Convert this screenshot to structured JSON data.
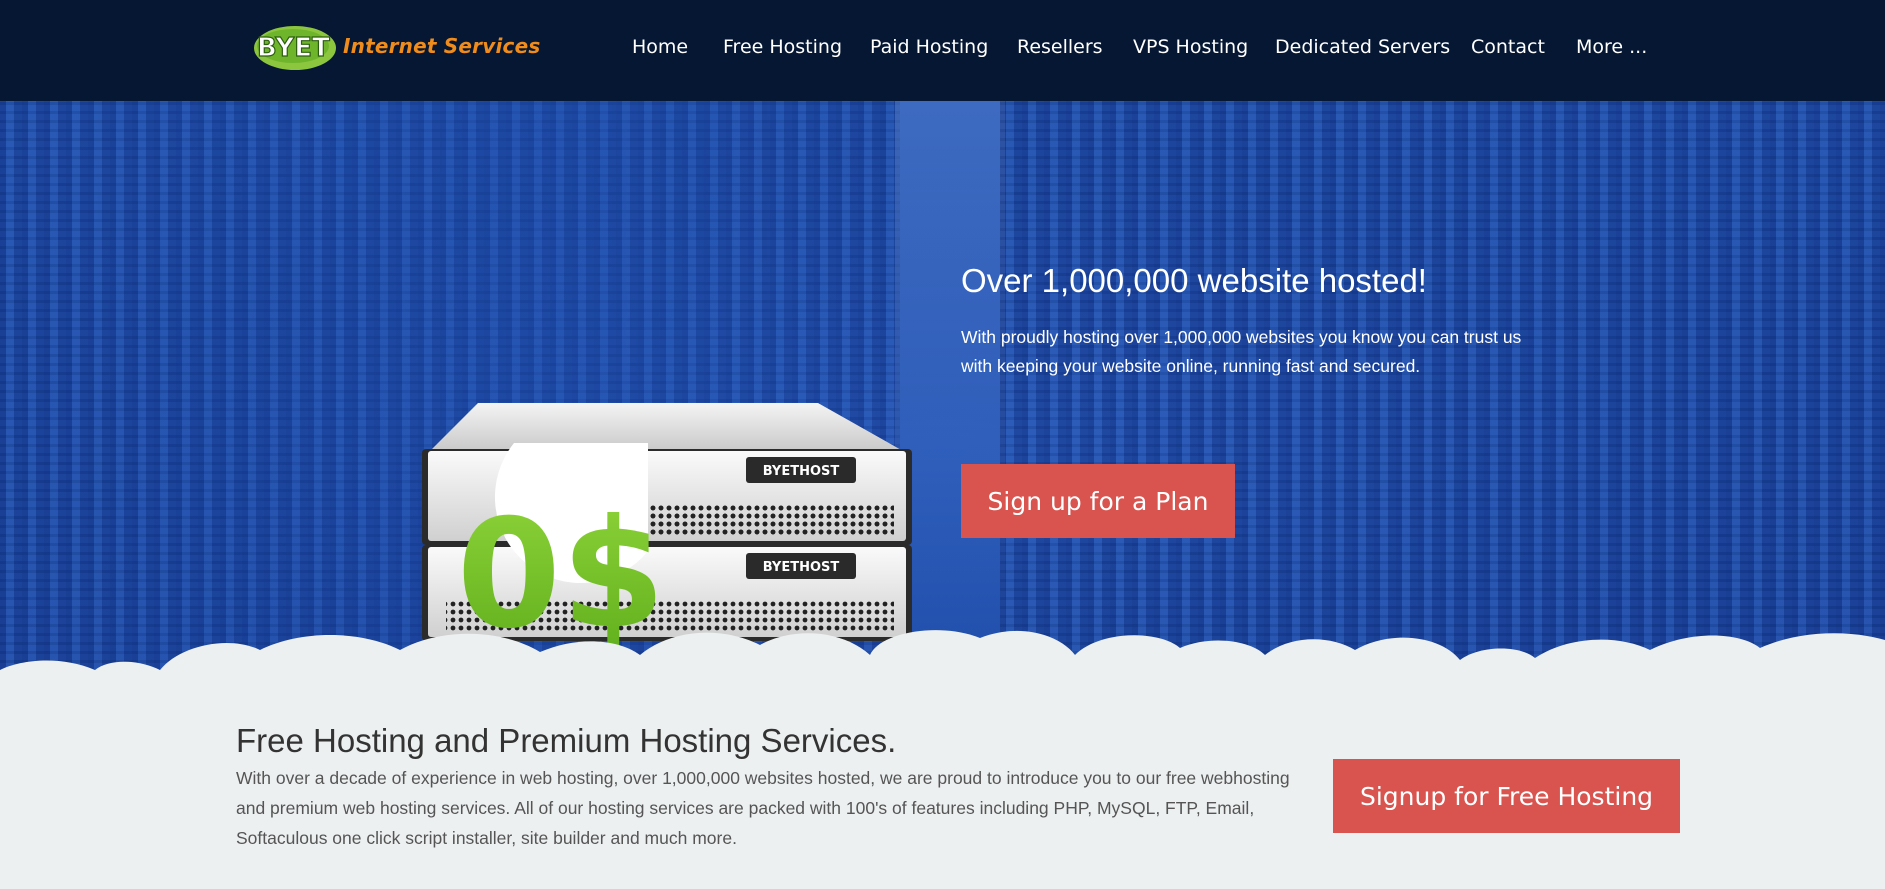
{
  "header": {
    "logo_text": "Internet Services",
    "logo_mark": "BYET",
    "nav": [
      {
        "label": "Home"
      },
      {
        "label": "Free Hosting"
      },
      {
        "label": "Paid Hosting"
      },
      {
        "label": "Resellers"
      },
      {
        "label": "VPS Hosting"
      },
      {
        "label": "Dedicated Servers"
      },
      {
        "label": "Contact"
      },
      {
        "label": "More ..."
      }
    ]
  },
  "hero": {
    "title": "Over 1,000,000 website hosted!",
    "text": "With proudly hosting over 1,000,000 websites you know you can trust us with keeping your website online, running fast and secured.",
    "cta_label": "Sign up for a Plan",
    "server_badge": "0$",
    "server_brand": "BYETHOST"
  },
  "intro": {
    "title": "Free Hosting and Premium Hosting Services.",
    "text": "With over a decade of experience in web hosting, over 1,000,000 websites hosted, we are proud to introduce you to our free webhosting and premium web hosting services. All of our hosting services are packed with 100's of features including PHP, MySQL, FTP, Email, Softaculous one click script installer, site builder and much more.",
    "cta_label": "Signup for Free Hosting"
  },
  "colors": {
    "header_bg": "#051732",
    "hero_blue": "#1d4caa",
    "accent_red": "#d9534f",
    "logo_orange": "#f08c1c",
    "logo_green": "#7ac943",
    "section_bg": "#edf0f1"
  }
}
